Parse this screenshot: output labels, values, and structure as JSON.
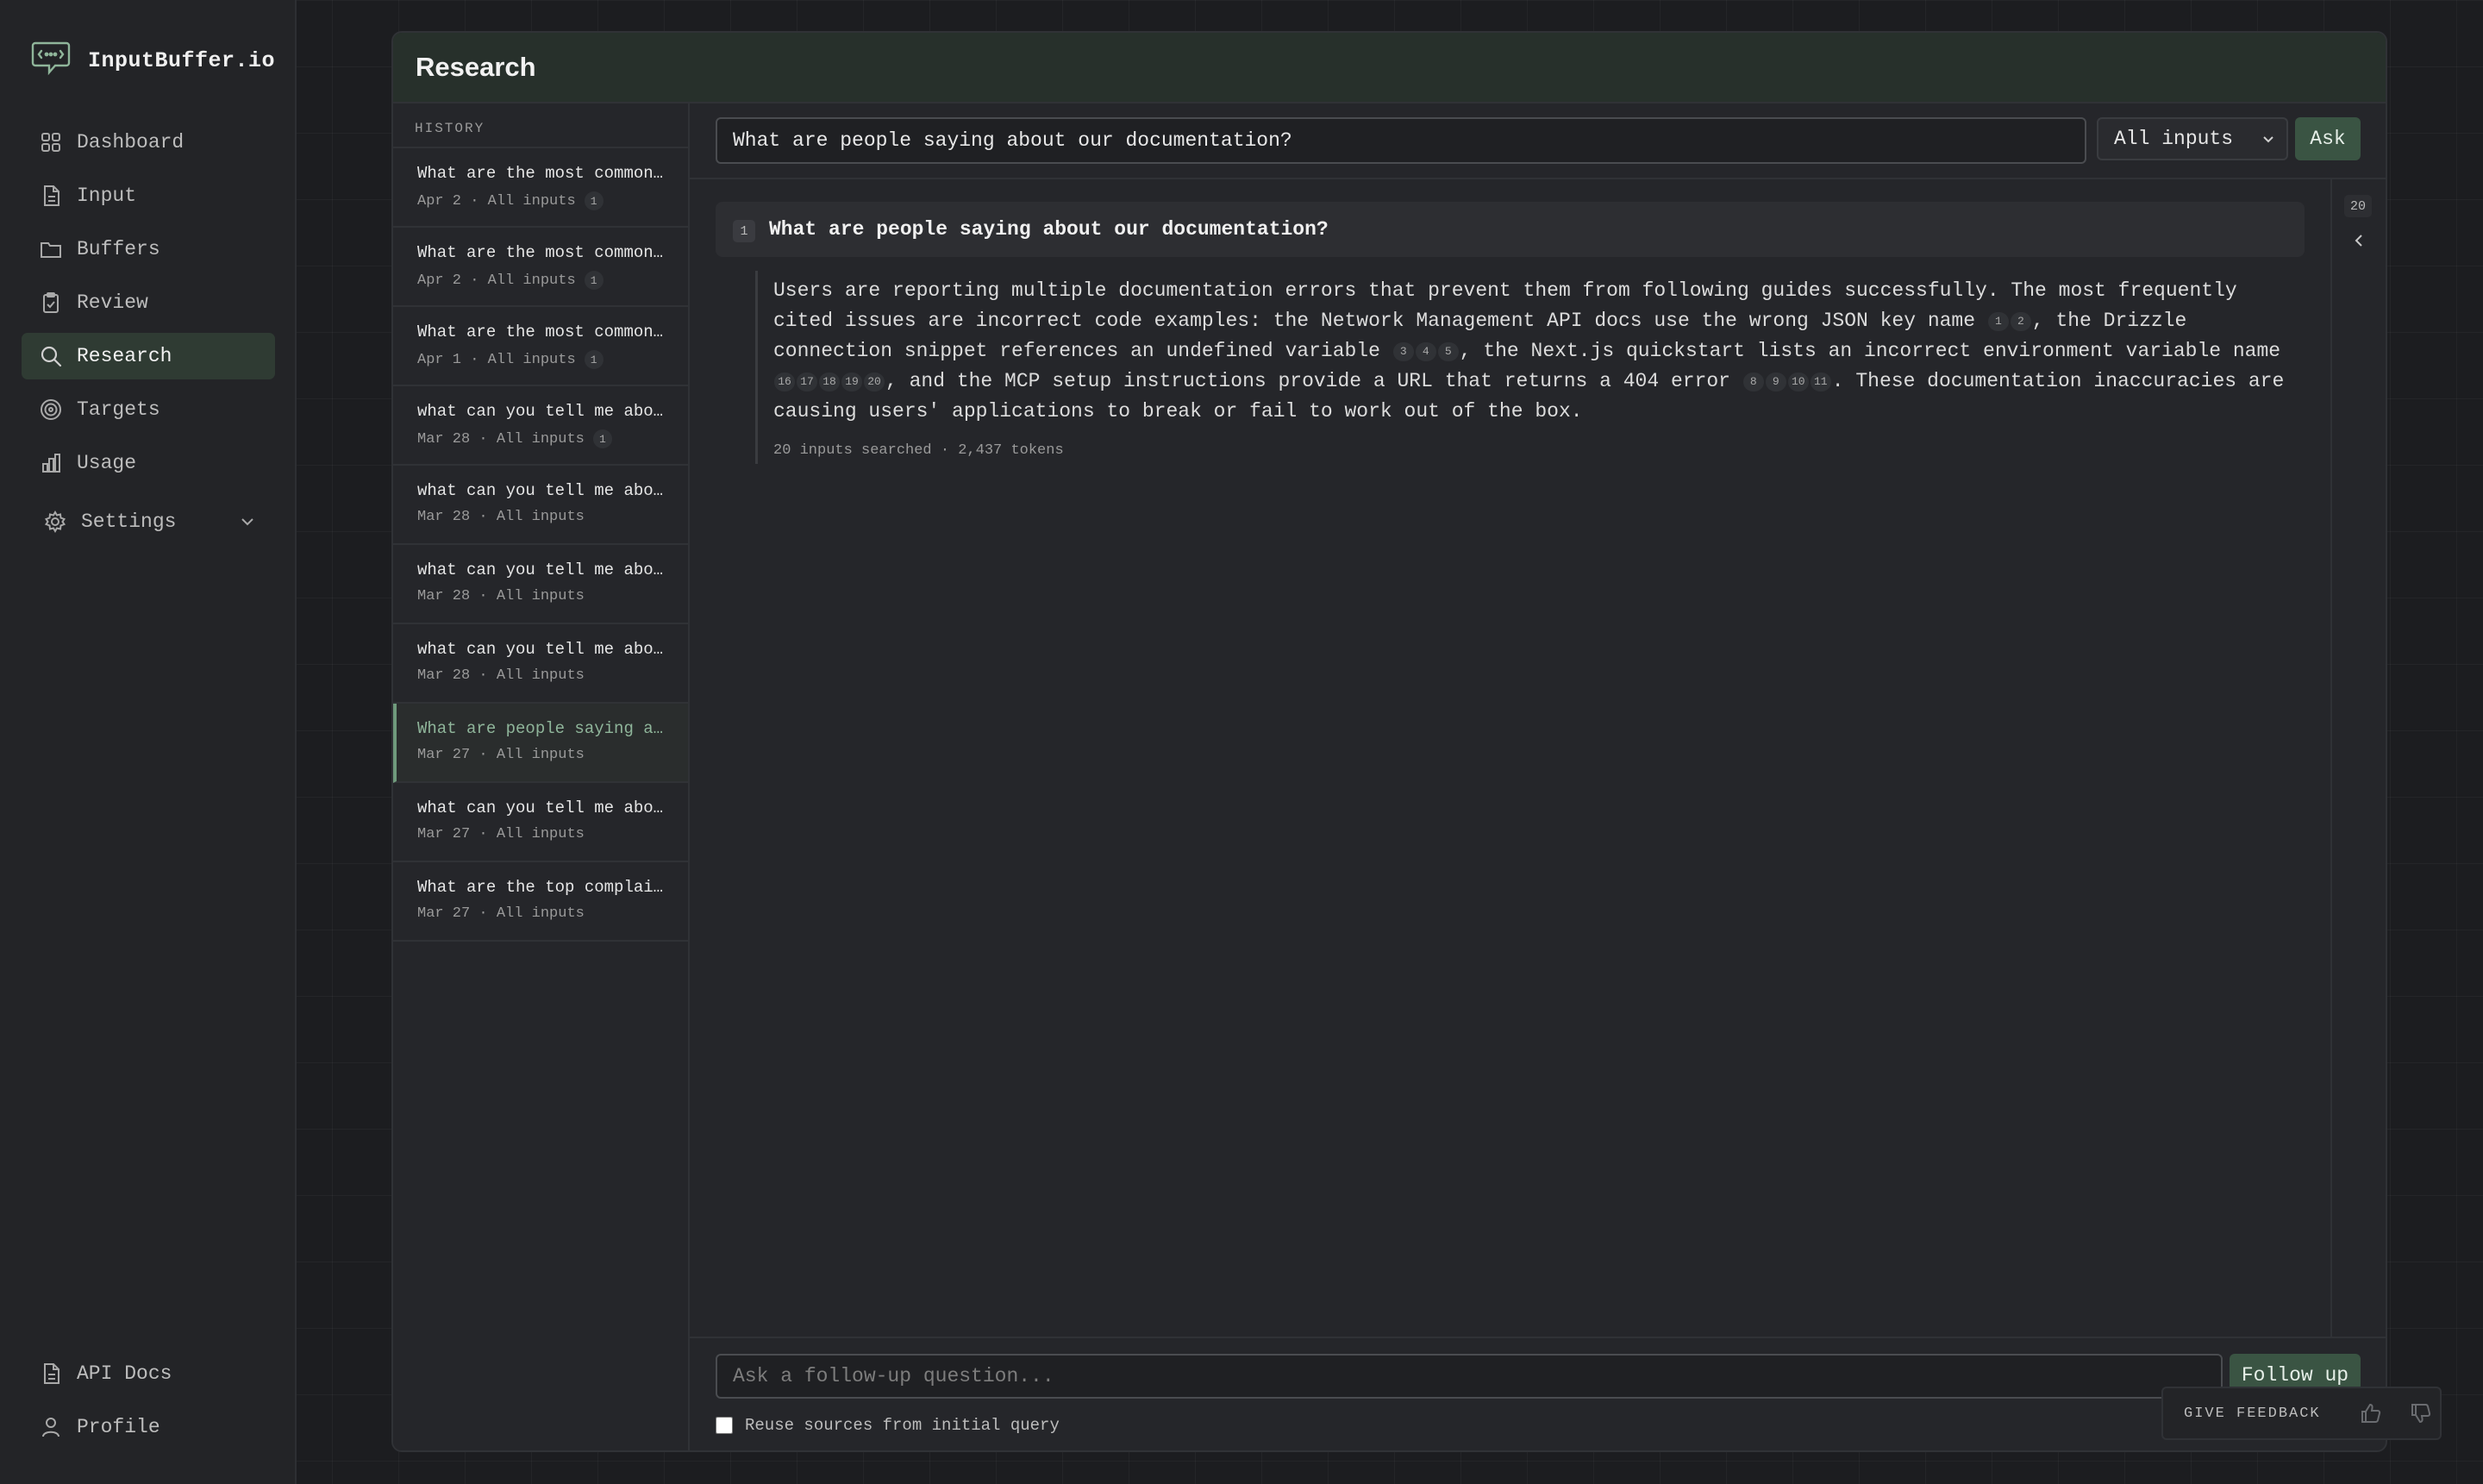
{
  "brand": {
    "name": "InputBuffer.io",
    "icon": "chat-bubble-icon"
  },
  "nav": {
    "items": [
      {
        "label": "Dashboard",
        "icon": "grid-icon"
      },
      {
        "label": "Input",
        "icon": "document-icon"
      },
      {
        "label": "Buffers",
        "icon": "folder-icon"
      },
      {
        "label": "Review",
        "icon": "clipboard-icon"
      },
      {
        "label": "Research",
        "icon": "search-icon",
        "active": true
      },
      {
        "label": "Targets",
        "icon": "target-icon"
      },
      {
        "label": "Usage",
        "icon": "bar-chart-icon"
      }
    ],
    "settings": {
      "label": "Settings",
      "icon": "gear-icon"
    },
    "bottom": [
      {
        "label": "API Docs",
        "icon": "document-icon"
      },
      {
        "label": "Profile",
        "icon": "user-icon"
      }
    ]
  },
  "panel": {
    "title": "Research"
  },
  "history": {
    "label": "HISTORY",
    "items": [
      {
        "question": "What are the most common issues reported?",
        "date": "Apr 2",
        "scope": "All inputs",
        "count": "1"
      },
      {
        "question": "What are the most common issues reported?",
        "date": "Apr 2",
        "scope": "All inputs",
        "count": "1"
      },
      {
        "question": "What are the most common issues reported?",
        "date": "Apr 1",
        "scope": "All inputs",
        "count": "1"
      },
      {
        "question": "what can you tell me about our users?",
        "date": "Mar 28",
        "scope": "All inputs",
        "count": "1"
      },
      {
        "question": "what can you tell me about our users?",
        "date": "Mar 28",
        "scope": "All inputs",
        "count": ""
      },
      {
        "question": "what can you tell me about our users?",
        "date": "Mar 28",
        "scope": "All inputs",
        "count": ""
      },
      {
        "question": "what can you tell me about our users?",
        "date": "Mar 28",
        "scope": "All inputs",
        "count": ""
      },
      {
        "question": "What are people saying about our documentation?",
        "date": "Mar 27",
        "scope": "All inputs",
        "count": "",
        "active": true
      },
      {
        "question": "what can you tell me about our users?",
        "date": "Mar 27",
        "scope": "All inputs",
        "count": ""
      },
      {
        "question": "What are the top complaints from users?",
        "date": "Mar 27",
        "scope": "All inputs",
        "count": ""
      }
    ]
  },
  "query": {
    "value": "What are people saying about our documentation?",
    "scope": "All inputs",
    "ask_label": "Ask"
  },
  "answer": {
    "number": "1",
    "question": "What are people saying about our documentation?",
    "segments": [
      {
        "text": "Users are reporting multiple documentation errors that prevent them from following guides successfully. The most frequently cited issues are incorrect code examples: the Network Management API docs use the wrong JSON key name ",
        "cites": [
          "1",
          "2"
        ]
      },
      {
        "text": ", the Drizzle connection snippet references an undefined variable ",
        "cites": [
          "3",
          "4",
          "5"
        ]
      },
      {
        "text": ", the Next.js quickstart lists an incorrect environment variable name ",
        "cites": [
          "16",
          "17",
          "18",
          "19",
          "20"
        ]
      },
      {
        "text": ", and the MCP setup instructions provide a URL that returns a 404 error ",
        "cites": [
          "8",
          "9",
          "10",
          "11"
        ]
      },
      {
        "text": ". These documentation inaccuracies are causing users' applications to break or fail to work out of the box.",
        "cites": []
      }
    ],
    "meta": "20 inputs searched · 2,437 tokens"
  },
  "sources": {
    "count": "20"
  },
  "followup": {
    "placeholder": "Ask a follow-up question...",
    "button_label": "Follow up",
    "reuse_label": "Reuse sources from initial query"
  },
  "feedback": {
    "label": "GIVE FEEDBACK"
  },
  "colors": {
    "accent": "#3a5443",
    "active_nav": "#2f3b33",
    "highlight_text": "#8fb59a"
  }
}
